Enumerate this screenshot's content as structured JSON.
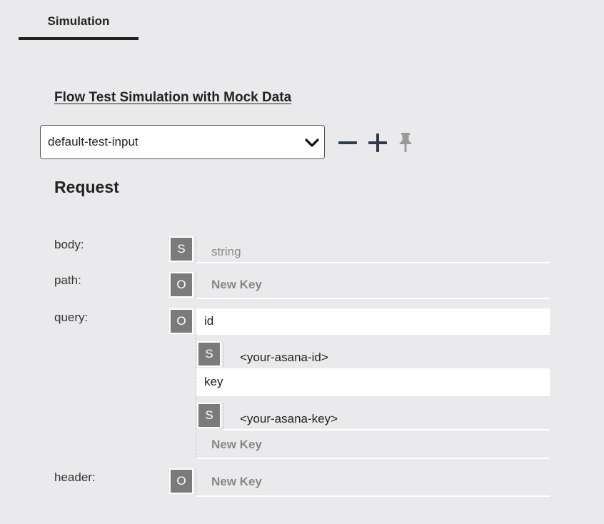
{
  "tabs": [
    {
      "label": "Simulation"
    }
  ],
  "section_title": "Flow Test Simulation with Mock Data",
  "selector": {
    "value": "default-test-input"
  },
  "request": {
    "title": "Request",
    "fields": {
      "body": {
        "label": "body:",
        "type_badge": "S",
        "placeholder": "string"
      },
      "path": {
        "label": "path:",
        "type_badge": "O",
        "new_key": "New Key"
      },
      "query": {
        "label": "query:",
        "type_badge": "O",
        "entries": [
          {
            "key": "id",
            "type_badge": "S",
            "value": "<your-asana-id>"
          },
          {
            "key": "key",
            "type_badge": "S",
            "value": "<your-asana-key>"
          }
        ],
        "new_key": "New Key"
      },
      "header": {
        "label": "header:",
        "type_badge": "O",
        "new_key": "New Key"
      }
    }
  }
}
